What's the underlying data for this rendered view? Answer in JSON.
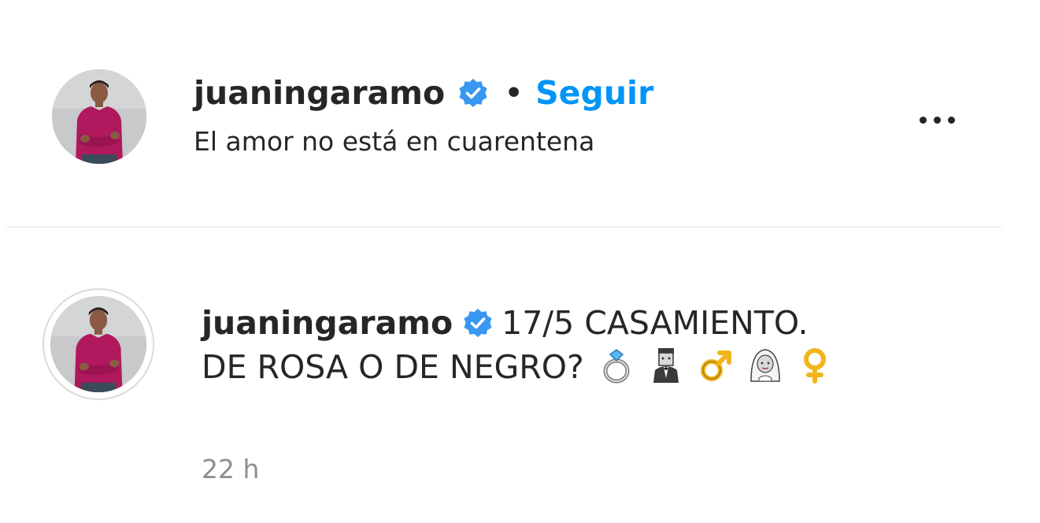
{
  "header": {
    "username": "juaningaramo",
    "separator": "•",
    "follow_label": "Seguir",
    "location": "El amor no está en cuarentena",
    "more_icon": "more-options-icon"
  },
  "comment": {
    "username": "juaningaramo",
    "caption_line1": "17/5 CASAMIENTO.",
    "caption_line2": "DE ROSA O DE NEGRO?",
    "emojis": [
      "ring-emoji",
      "man-in-tuxedo-emoji",
      "male-sign-emoji",
      "bride-with-veil-emoji",
      "female-sign-emoji"
    ],
    "time": "22 h"
  },
  "colors": {
    "accent": "#0095f6",
    "text": "#262626",
    "secondary": "#8e8e8e",
    "divider": "#efefef",
    "verified": "#3897f0"
  }
}
